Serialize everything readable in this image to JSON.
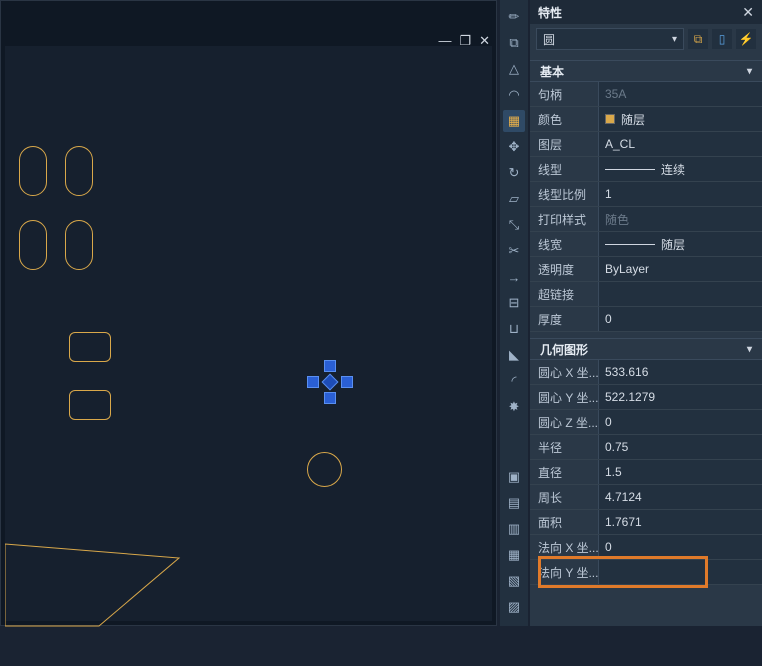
{
  "panel": {
    "title": "特性",
    "selector": "圆"
  },
  "sections": {
    "basic": "基本",
    "geom": "几何图形"
  },
  "basic": {
    "handle_label": "句柄",
    "handle_value": "35A",
    "color_label": "颜色",
    "color_value": "随层",
    "layer_label": "图层",
    "layer_value": "A_CL",
    "linetype_label": "线型",
    "linetype_value": "连续",
    "linescale_label": "线型比例",
    "linescale_value": "1",
    "printstyle_label": "打印样式",
    "printstyle_value": "随色",
    "lineweight_label": "线宽",
    "lineweight_value": "随层",
    "transparency_label": "透明度",
    "transparency_value": "ByLayer",
    "hyperlink_label": "超链接",
    "hyperlink_value": "",
    "thickness_label": "厚度",
    "thickness_value": "0"
  },
  "geom": {
    "cx_label": "圆心 X 坐...",
    "cx_value": "533.616",
    "cy_label": "圆心 Y 坐...",
    "cy_value": "522.1279",
    "cz_label": "圆心 Z 坐...",
    "cz_value": "0",
    "radius_label": "半径",
    "radius_value": "0.75",
    "diameter_label": "直径",
    "diameter_value": "1.5",
    "circumference_label": "周长",
    "circumference_value": "4.7124",
    "area_label": "面积",
    "area_value": "1.7671",
    "normx_label": "法向 X 坐...",
    "normx_value": "0",
    "normy_label": "法向 Y 坐...",
    "normy_value": ""
  }
}
